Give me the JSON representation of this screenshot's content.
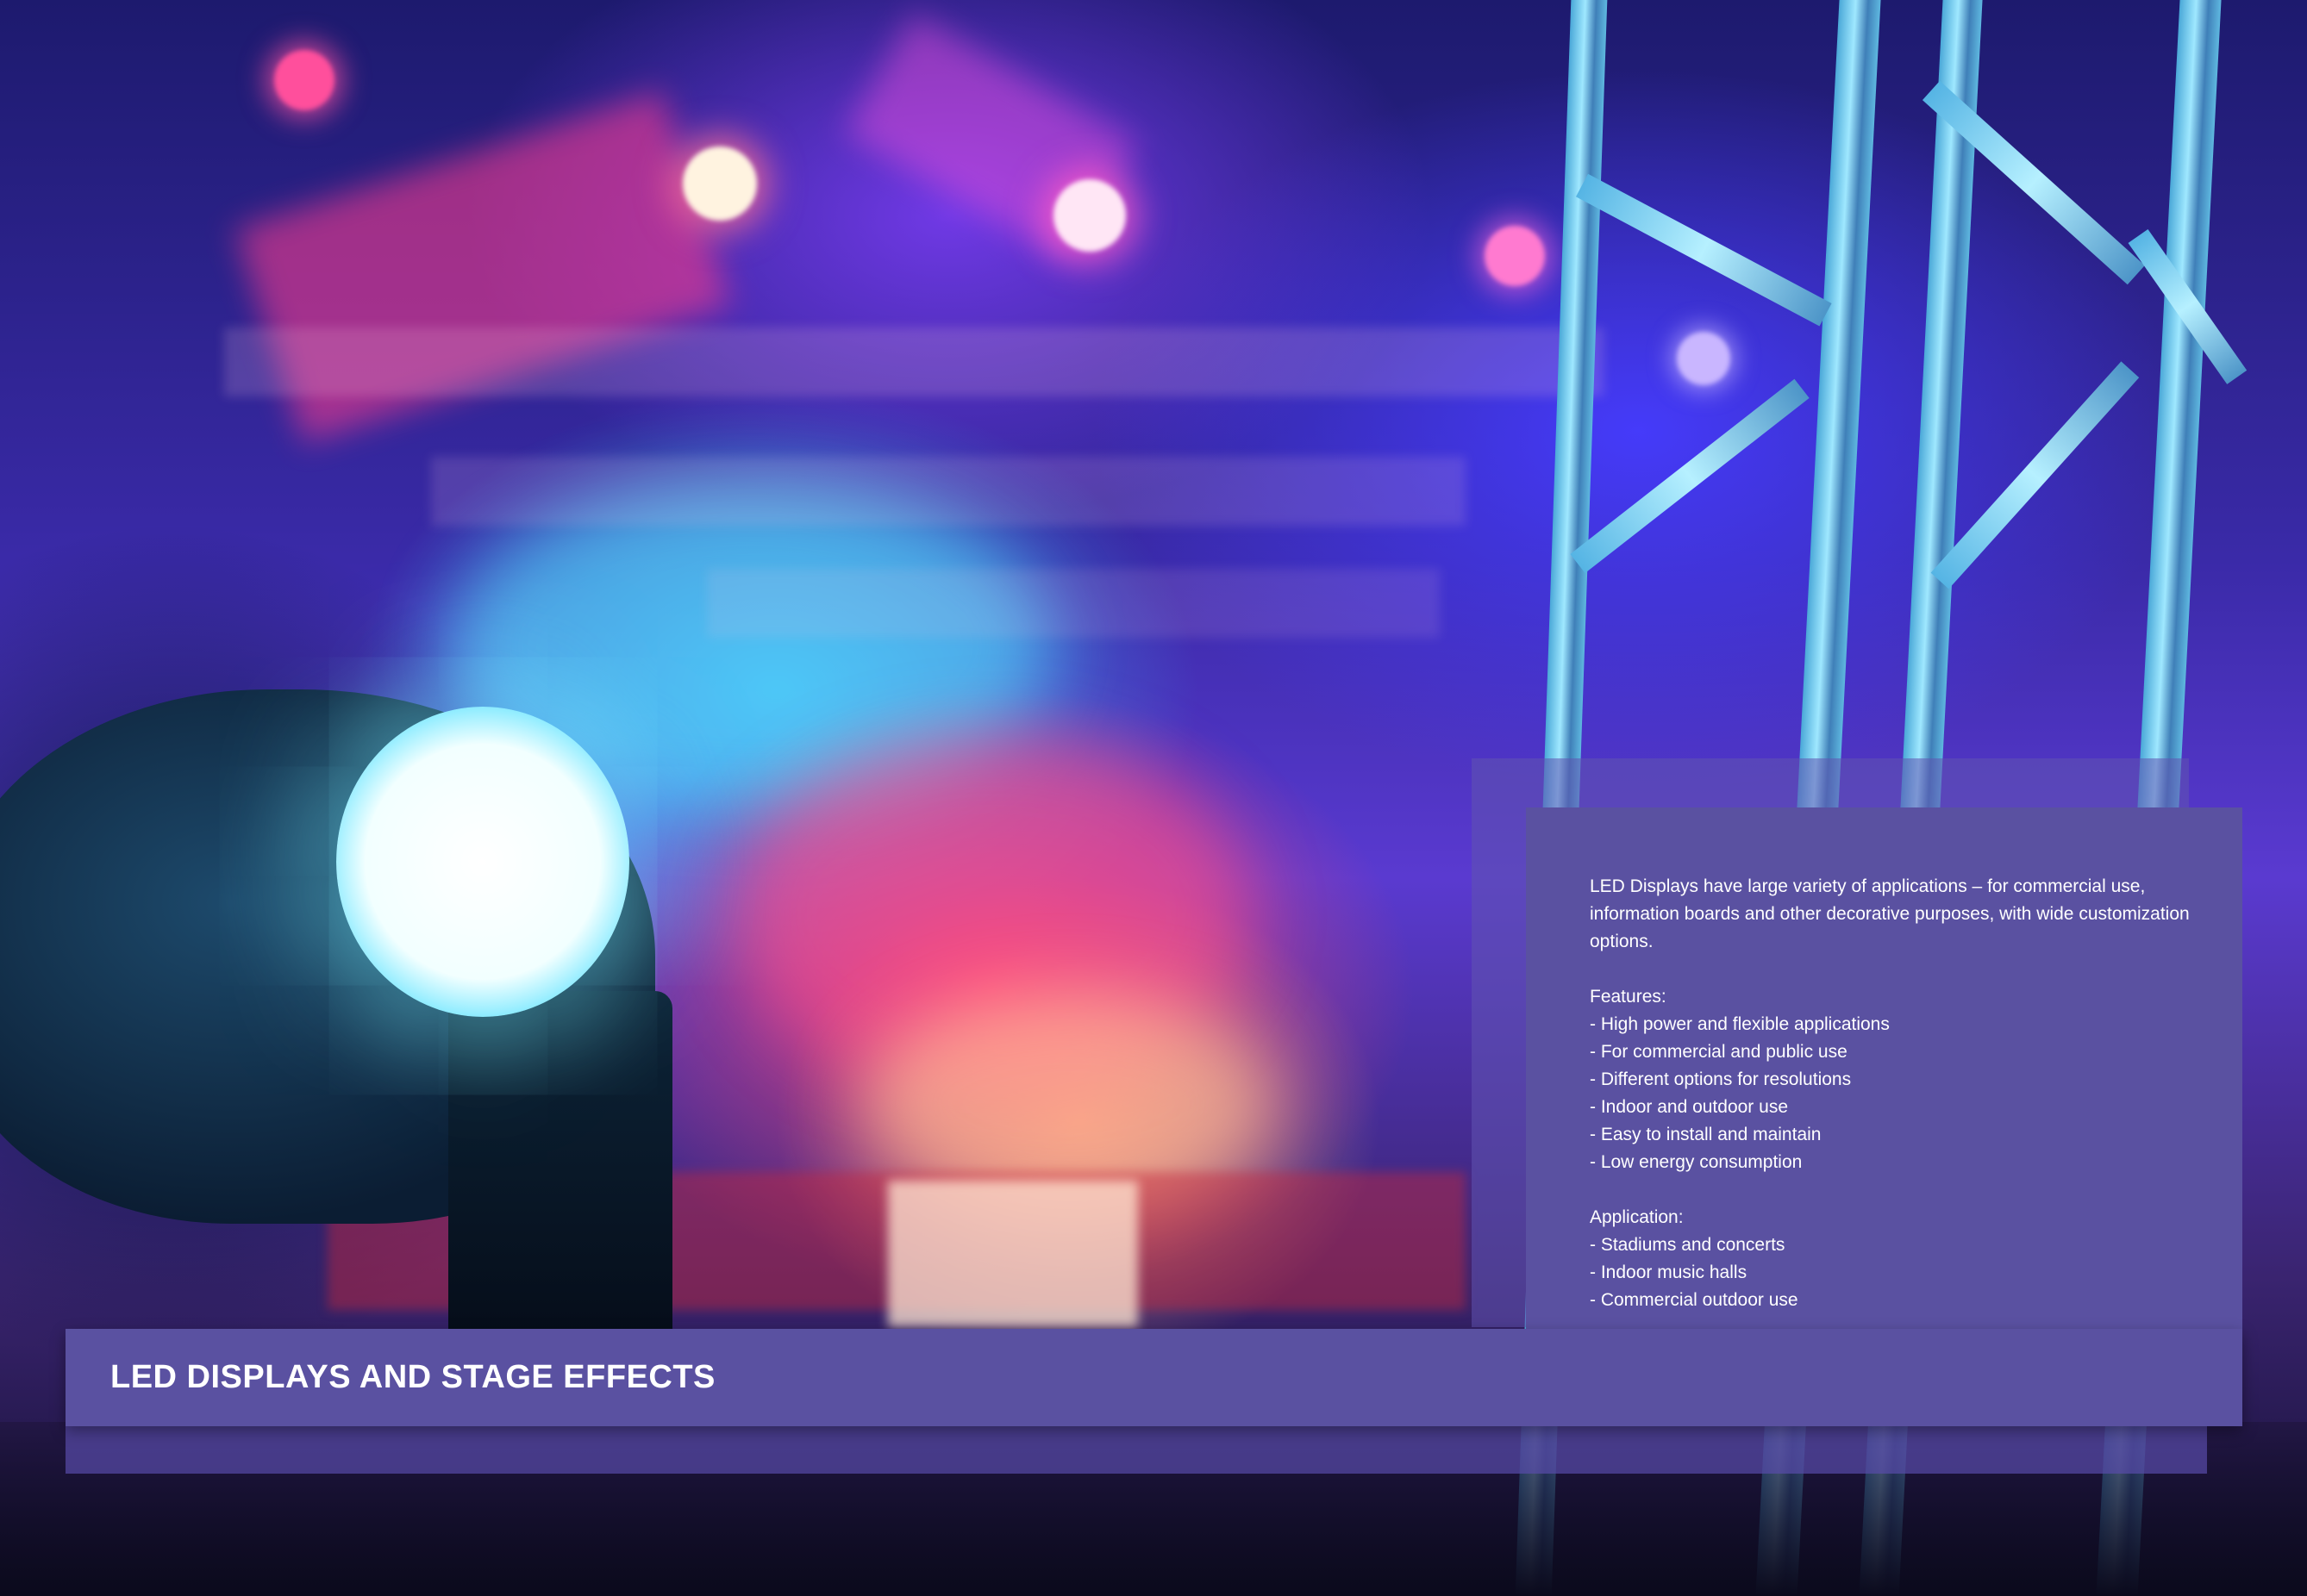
{
  "title": "LED DISPLAYS AND STAGE EFFECTS",
  "intro": "LED Displays have large variety of applications – for commercial use, information boards and other decorative purposes, with wide customization options.",
  "features": {
    "heading": "Features:",
    "items": [
      "- High power and flexible applications",
      "- For commercial and public use",
      "- Different options for resolutions",
      "- Indoor and outdoor use",
      "- Easy to install and maintain",
      "- Low energy consumption"
    ]
  },
  "application": {
    "heading": "Application:",
    "items": [
      "- Stadiums and concerts",
      "- Indoor music halls",
      "- Commercial outdoor use"
    ]
  },
  "colors": {
    "panel": "#5a51a1",
    "text": "#ffffff"
  }
}
